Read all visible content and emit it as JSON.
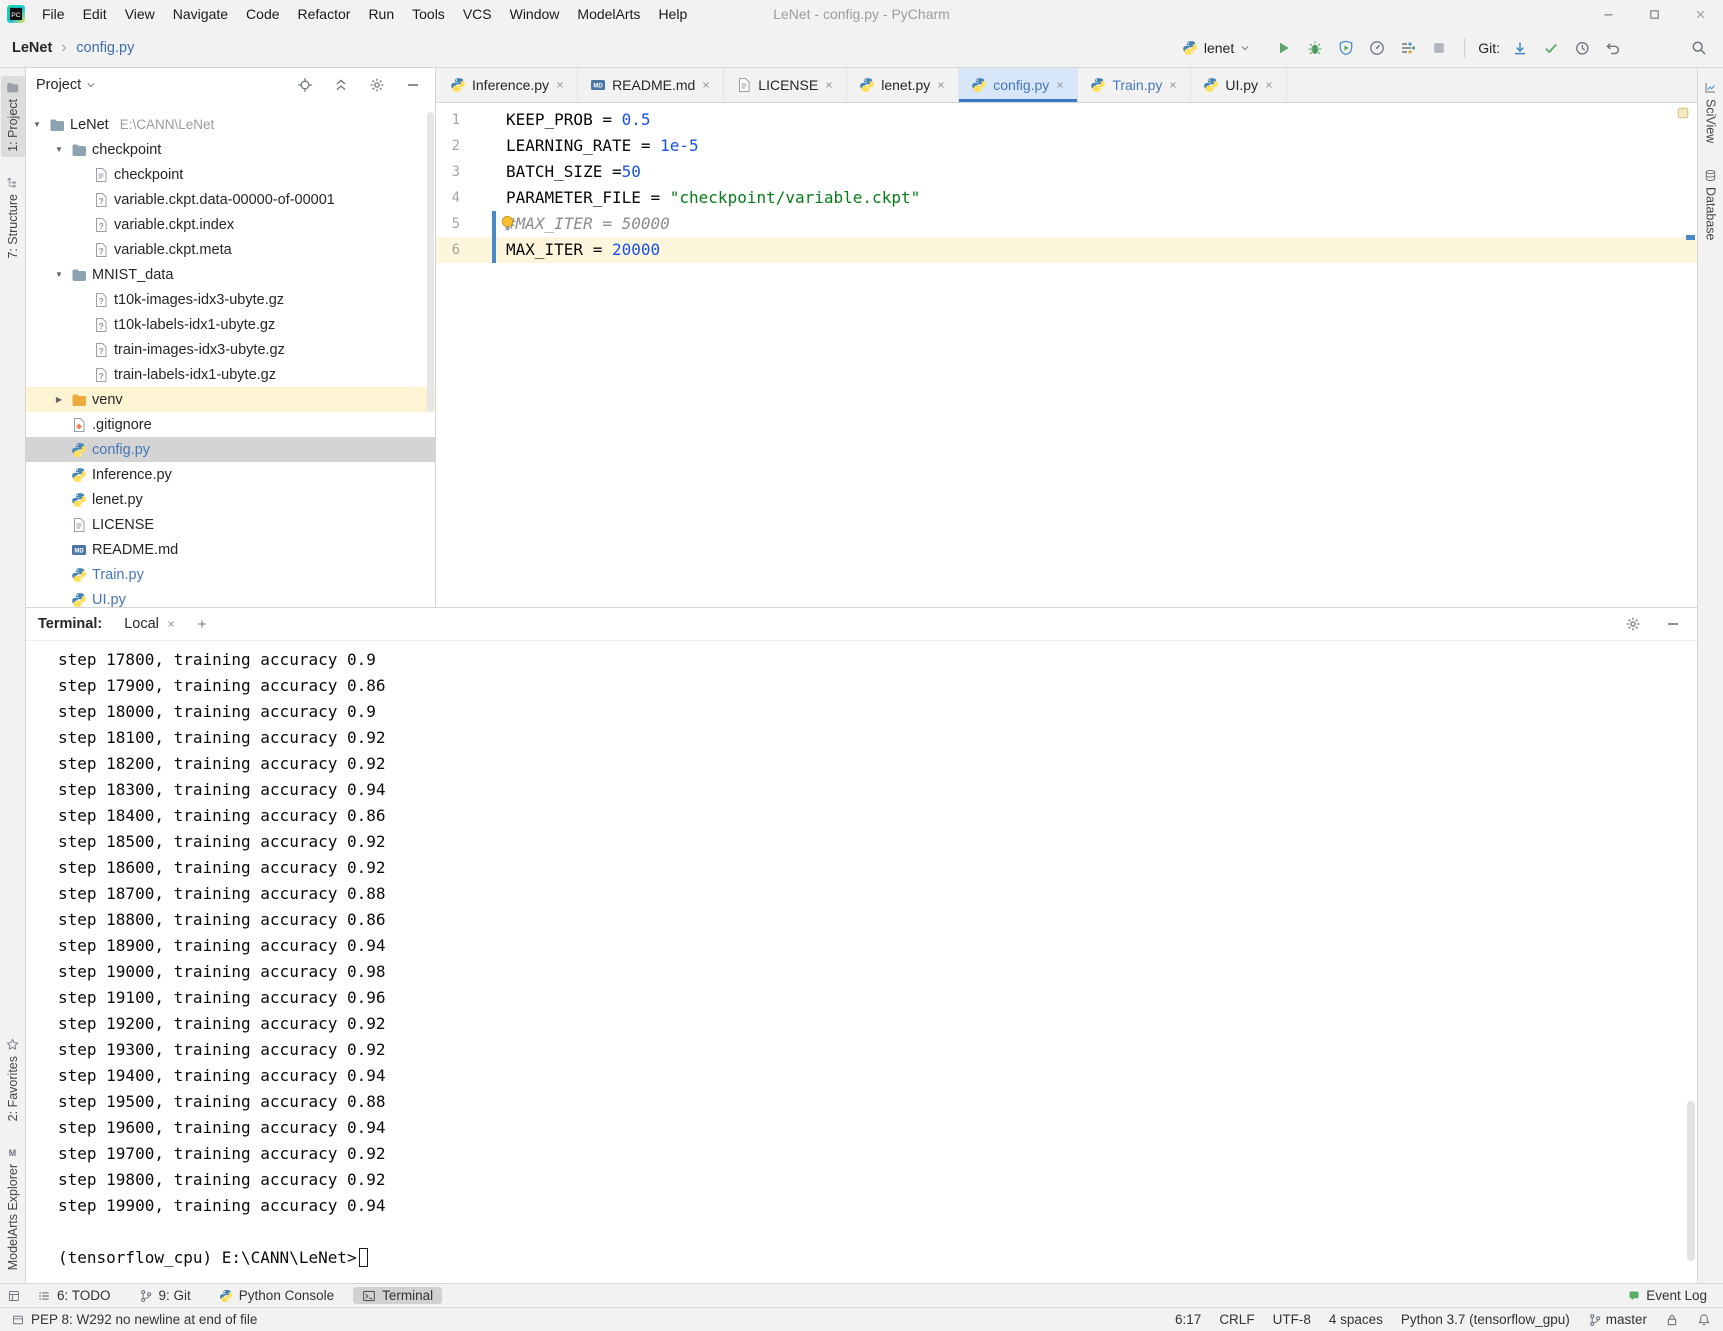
{
  "titlebar": {
    "title": "LeNet - config.py - PyCharm",
    "menus": [
      "File",
      "Edit",
      "View",
      "Navigate",
      "Code",
      "Refactor",
      "Run",
      "Tools",
      "VCS",
      "Window",
      "ModelArts",
      "Help"
    ],
    "window_controls": [
      "minimize",
      "maximize",
      "close"
    ]
  },
  "toolbar": {
    "breadcrumb_project": "LeNet",
    "breadcrumb_file": "config.py",
    "run_config": "lenet",
    "actions": [
      "run",
      "debug",
      "coverage",
      "profiler",
      "concurrency",
      "stop"
    ],
    "git_label": "Git:",
    "git_actions": [
      "git-update",
      "git-commit",
      "git-history",
      "git-rollback"
    ],
    "search_icon": "search"
  },
  "left_stripe": {
    "top": [
      {
        "label": "1: Project",
        "icon": "project-tool",
        "active": true
      },
      {
        "label": "7: Structure",
        "icon": "structure-tool",
        "active": false
      }
    ],
    "bottom": [
      {
        "label": "2: Favorites",
        "icon": "favorites-star",
        "active": false
      },
      {
        "label": "ModelArts Explorer",
        "icon": "modelarts",
        "active": false
      }
    ]
  },
  "right_stripe": [
    {
      "label": "SciView",
      "icon": "sciview"
    },
    {
      "label": "Database",
      "icon": "database"
    }
  ],
  "project": {
    "header": "Project",
    "toolbar": [
      "locate",
      "collapse-all",
      "gear",
      "hide"
    ],
    "tree": [
      {
        "label": "LeNet",
        "extra": "E:\\CANN\\LeNet",
        "icon": "folder",
        "indent": 0,
        "arrow": "down"
      },
      {
        "label": "checkpoint",
        "icon": "folder",
        "indent": 1,
        "arrow": "down"
      },
      {
        "label": "checkpoint",
        "icon": "text-file",
        "indent": 2
      },
      {
        "label": "variable.ckpt.data-00000-of-00001",
        "icon": "unknown-file",
        "indent": 2
      },
      {
        "label": "variable.ckpt.index",
        "icon": "unknown-file",
        "indent": 2
      },
      {
        "label": "variable.ckpt.meta",
        "icon": "unknown-file",
        "indent": 2
      },
      {
        "label": "MNIST_data",
        "icon": "folder",
        "indent": 1,
        "arrow": "down"
      },
      {
        "label": "t10k-images-idx3-ubyte.gz",
        "icon": "unknown-file",
        "indent": 2
      },
      {
        "label": "t10k-labels-idx1-ubyte.gz",
        "icon": "unknown-file",
        "indent": 2
      },
      {
        "label": "train-images-idx3-ubyte.gz",
        "icon": "unknown-file",
        "indent": 2
      },
      {
        "label": "train-labels-idx1-ubyte.gz",
        "icon": "unknown-file",
        "indent": 2
      },
      {
        "label": "venv",
        "icon": "folder-excluded",
        "indent": 1,
        "arrow": "right",
        "highlight": true
      },
      {
        "label": ".gitignore",
        "icon": "gitignore-file",
        "indent": 1
      },
      {
        "label": "config.py",
        "icon": "python-file",
        "indent": 1,
        "selected": true,
        "modified": true
      },
      {
        "label": "Inference.py",
        "icon": "python-file",
        "indent": 1
      },
      {
        "label": "lenet.py",
        "icon": "python-file",
        "indent": 1
      },
      {
        "label": "LICENSE",
        "icon": "text-file",
        "indent": 1
      },
      {
        "label": "README.md",
        "icon": "markdown-file",
        "indent": 1
      },
      {
        "label": "Train.py",
        "icon": "python-file",
        "indent": 1,
        "modified": true
      },
      {
        "label": "UI.py",
        "icon": "python-file",
        "indent": 1,
        "modified": true
      }
    ]
  },
  "tabs": [
    {
      "label": "Inference.py",
      "icon": "python-file"
    },
    {
      "label": "README.md",
      "icon": "markdown-file"
    },
    {
      "label": "LICENSE",
      "icon": "text-file"
    },
    {
      "label": "lenet.py",
      "icon": "python-file"
    },
    {
      "label": "config.py",
      "icon": "python-file",
      "active": true,
      "modified": true
    },
    {
      "label": "Train.py",
      "icon": "python-file",
      "modified": true
    },
    {
      "label": "UI.py",
      "icon": "python-file"
    }
  ],
  "editor": {
    "lines": [
      {
        "num": "1",
        "tokens": [
          {
            "t": "KEEP_PROB = ",
            "c": "p"
          },
          {
            "t": "0.5",
            "c": "n"
          }
        ]
      },
      {
        "num": "2",
        "tokens": [
          {
            "t": "LEARNING_RATE = ",
            "c": "p"
          },
          {
            "t": "1e-5",
            "c": "n"
          }
        ]
      },
      {
        "num": "3",
        "tokens": [
          {
            "t": "BATCH_SIZE =",
            "c": "p"
          },
          {
            "t": "50",
            "c": "n"
          }
        ]
      },
      {
        "num": "4",
        "tokens": [
          {
            "t": "PARAMETER_FILE = ",
            "c": "p"
          },
          {
            "t": "\"checkpoint/variable.ckpt\"",
            "c": "s"
          }
        ]
      },
      {
        "num": "5",
        "tokens": [
          {
            "t": "#MAX_ITER = 50000",
            "c": "c"
          }
        ],
        "bulb": true,
        "changed": true
      },
      {
        "num": "6",
        "tokens": [
          {
            "t": "MAX_ITER = ",
            "c": "p"
          },
          {
            "t": "20000",
            "c": "n"
          }
        ],
        "current": true,
        "changed": true
      }
    ]
  },
  "terminal": {
    "label": "Terminal:",
    "tab": "Local",
    "actions": [
      "gear",
      "hide"
    ],
    "lines": [
      "step 17800, training accuracy 0.9",
      "step 17900, training accuracy 0.86",
      "step 18000, training accuracy 0.9",
      "step 18100, training accuracy 0.92",
      "step 18200, training accuracy 0.92",
      "step 18300, training accuracy 0.94",
      "step 18400, training accuracy 0.86",
      "step 18500, training accuracy 0.92",
      "step 18600, training accuracy 0.92",
      "step 18700, training accuracy 0.88",
      "step 18800, training accuracy 0.86",
      "step 18900, training accuracy 0.94",
      "step 19000, training accuracy 0.98",
      "step 19100, training accuracy 0.96",
      "step 19200, training accuracy 0.92",
      "step 19300, training accuracy 0.92",
      "step 19400, training accuracy 0.94",
      "step 19500, training accuracy 0.88",
      "step 19600, training accuracy 0.94",
      "step 19700, training accuracy 0.92",
      "step 19800, training accuracy 0.92",
      "step 19900, training accuracy 0.94"
    ],
    "prompt": "(tensorflow_cpu) E:\\CANN\\LeNet>"
  },
  "toolwindow_bar": {
    "items": [
      {
        "label": "6: TODO",
        "icon": "todo"
      },
      {
        "label": "9: Git",
        "icon": "branch"
      },
      {
        "label": "Python Console",
        "icon": "python-file"
      },
      {
        "label": "Terminal",
        "icon": "terminal-tool",
        "active": true
      }
    ],
    "event_log": "Event Log"
  },
  "status_bar": {
    "message": "PEP 8: W292 no newline at end of file",
    "items": [
      "6:17",
      "CRLF",
      "UTF-8",
      "4 spaces",
      "Python 3.7 (tensorflow_gpu)"
    ],
    "branch": "master"
  },
  "colors": {
    "accent_blue": "#3c78c1",
    "modified_blue": "#4676b8",
    "selection_gray": "#d4d4d4",
    "excluded_yellow": "#fcf4d3",
    "current_line": "#fdf6dd",
    "number": "#1750eb",
    "string": "#067d17",
    "comment": "#8c8c8c",
    "run_green": "#59a869"
  }
}
